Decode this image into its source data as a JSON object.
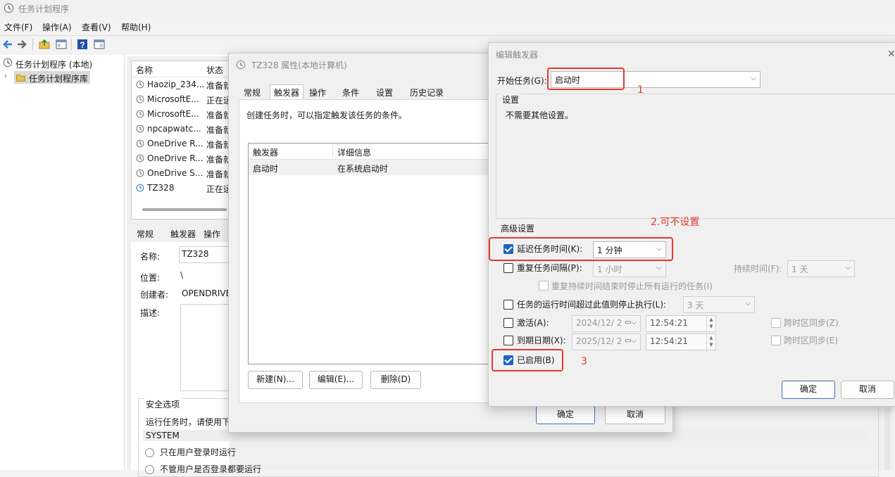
{
  "window": {
    "title": "任务计划程序"
  },
  "menu": [
    "文件(F)",
    "操作(A)",
    "查看(V)",
    "帮助(H)"
  ],
  "tree": {
    "root": "任务计划程序 (本地)",
    "library": "任务计划程序库"
  },
  "task_list": {
    "headers": [
      "名称",
      "状态"
    ],
    "rows": [
      {
        "name": "Haozip_234...",
        "status": "准备就"
      },
      {
        "name": "MicrosoftE...",
        "status": "正在运"
      },
      {
        "name": "MicrosoftE...",
        "status": "准备就"
      },
      {
        "name": "npcapwatc...",
        "status": "准备就"
      },
      {
        "name": "OneDrive R...",
        "status": "准备就"
      },
      {
        "name": "OneDrive R...",
        "status": "准备就"
      },
      {
        "name": "OneDrive S...",
        "status": "准备就"
      },
      {
        "name": "TZ328",
        "status": "正在运"
      }
    ]
  },
  "detail": {
    "tabs": [
      "常规",
      "触发器",
      "操作"
    ],
    "name_label": "名称:",
    "name_value": "TZ328",
    "location_label": "位置:",
    "location_value": "\\",
    "author_label": "创建者:",
    "author_value": "OPENDRIVE",
    "desc_label": "描述:",
    "security_title": "安全选项",
    "security_text": "运行任务时，请使用下",
    "security_account": "SYSTEM",
    "radio_logon": "只在用户登录时运行",
    "radio_any": "不管用户是否登录都要运行"
  },
  "props_dialog": {
    "title": "TZ328 属性(本地计算机)",
    "tabs": [
      "常规",
      "触发器",
      "操作",
      "条件",
      "设置",
      "历史记录"
    ],
    "hint": "创建任务时，可以指定触发该任务的条件。",
    "trigger_headers": [
      "触发器",
      "详细信息"
    ],
    "trigger_rows": [
      {
        "trigger": "启动时",
        "detail": "在系统启动时"
      }
    ],
    "btn_new": "新建(N)...",
    "btn_edit": "编辑(E)...",
    "btn_delete": "删除(D)",
    "btn_ok": "确定",
    "btn_cancel": "取消"
  },
  "edit_dialog": {
    "title": "编辑触发器",
    "begin_label": "开始任务(G):",
    "begin_value": "启动时",
    "settings_group": "设置",
    "settings_text": "不需要其他设置。",
    "advanced_group": "高级设置",
    "delay_label": "延迟任务时间(K):",
    "delay_value": "1 分钟",
    "repeat_label": "重复任务间隔(P):",
    "repeat_value": "1 小时",
    "duration_label": "持续时间(F):",
    "duration_value": "1 天",
    "stop_all_label": "重复持续时间结束时停止所有运行的任务(I)",
    "stop_long_label": "任务的运行时间超过此值则停止执行(L):",
    "stop_long_value": "3 天",
    "activate_label": "激活(A):",
    "activate_date": "2024/12/  2",
    "activate_time": "12:54:21",
    "expire_label": "到期日期(X):",
    "expire_date": "2025/12/  2",
    "expire_time": "12:54:21",
    "sync_tz_z": "跨时区同步(Z)",
    "sync_tz_e": "跨时区同步(E)",
    "enabled_label": "已启用(B)",
    "btn_ok": "确定",
    "btn_cancel": "取消"
  },
  "annotations": {
    "a1": "1",
    "a2": "2.可不设置",
    "a3": "3"
  },
  "colors": {
    "annotation": "#e0392f",
    "checkbox_checked": "#1f66c1"
  }
}
